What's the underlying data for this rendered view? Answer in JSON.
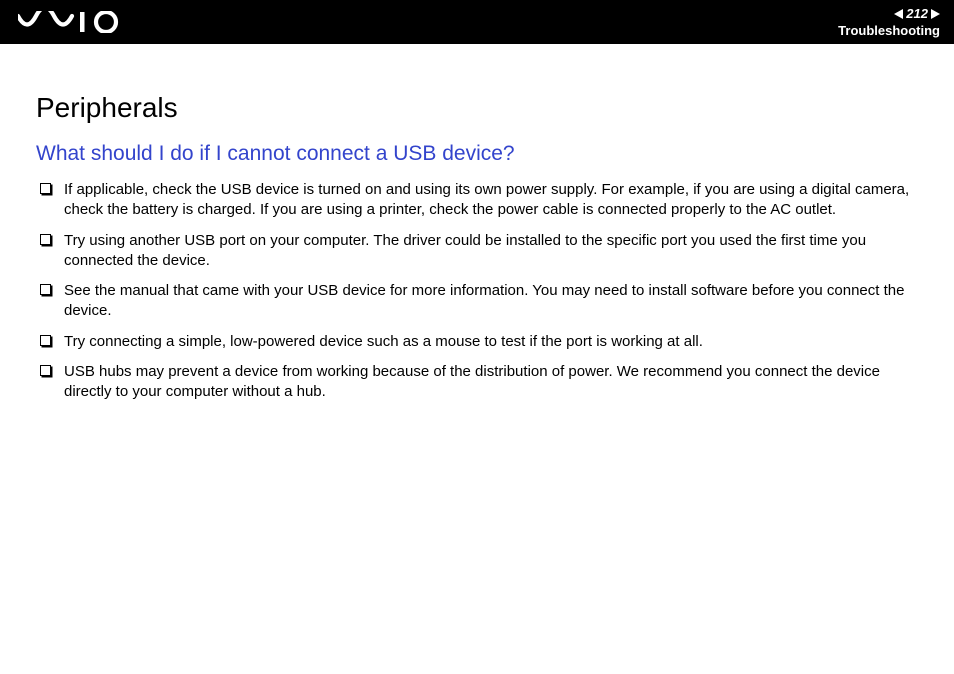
{
  "header": {
    "page_number": "212",
    "section": "Troubleshooting"
  },
  "content": {
    "title": "Peripherals",
    "question": "What should I do if I cannot connect a USB device?",
    "bullets": [
      "If applicable, check the USB device is turned on and using its own power supply. For example, if you are using a digital camera, check the battery is charged. If you are using a printer, check the power cable is connected properly to the AC outlet.",
      "Try using another USB port on your computer. The driver could be installed to the specific port you used the first time you connected the device.",
      "See the manual that came with your USB device for more information. You may need to install software before you connect the device.",
      "Try connecting a simple, low-powered device such as a mouse to test if the port is working at all.",
      "USB hubs may prevent a device from working because of the distribution of power. We recommend you connect the device directly to your computer without a hub."
    ]
  }
}
